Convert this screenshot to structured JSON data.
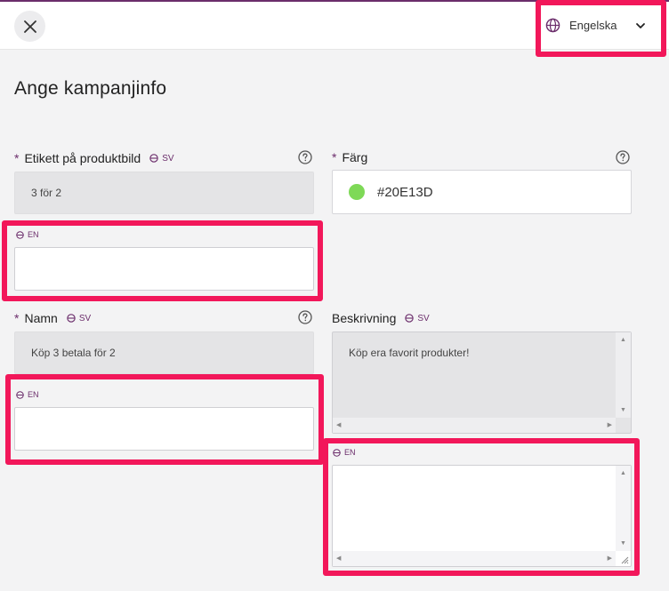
{
  "header": {
    "language_label": "Engelska"
  },
  "page_title": "Ange kampanjinfo",
  "fields": {
    "product_label": {
      "label": "Etikett på produktbild",
      "required_mark": "*",
      "source_lang": "SV",
      "source_value": "3 för 2",
      "target_lang": "EN",
      "target_value": ""
    },
    "color": {
      "label": "Färg",
      "required_mark": "*",
      "value": "#20E13D",
      "swatch": "#7ed957"
    },
    "name": {
      "label": "Namn",
      "required_mark": "*",
      "source_lang": "SV",
      "source_value": "Köp 3 betala för 2",
      "target_lang": "EN",
      "target_value": ""
    },
    "description": {
      "label": "Beskrivning",
      "source_lang": "SV",
      "source_value": "Köp era favorit produkter!",
      "target_lang": "EN",
      "target_value": ""
    }
  },
  "colors": {
    "accent": "#6b2d6b",
    "highlight": "#f2175a"
  },
  "icons": {
    "close": "close-icon",
    "globe": "globe-icon",
    "chevron": "chevron-down-icon",
    "help": "help-icon"
  }
}
